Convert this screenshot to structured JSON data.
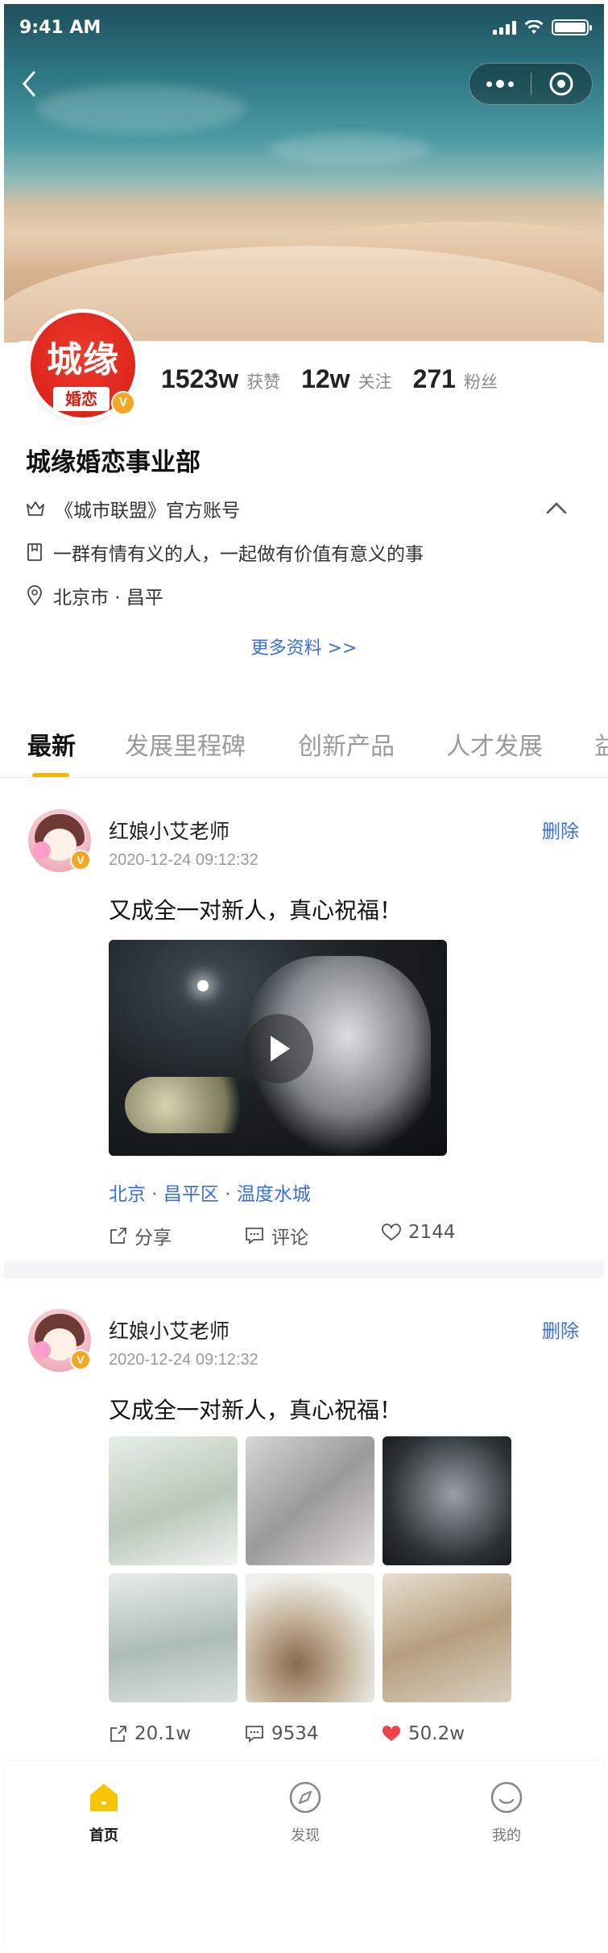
{
  "status_bar": {
    "time": "9:41 AM"
  },
  "profile": {
    "logo_text": "城缘",
    "logo_sub": "婚恋",
    "verified_mark": "V",
    "stats": [
      {
        "value": "1523w",
        "label": "获赞"
      },
      {
        "value": "12w",
        "label": "关注"
      },
      {
        "value": "271",
        "label": "粉丝"
      }
    ],
    "name": "城缘婚恋事业部",
    "official": "《城市联盟》官方账号",
    "motto": "一群有情有义的人，一起做有价值有意义的事",
    "location": "北京市 · 昌平",
    "more_link": "更多资料 >>"
  },
  "tabs": [
    "最新",
    "发展里程碑",
    "创新产品",
    "人才发展",
    "益"
  ],
  "posts": [
    {
      "author": "红娘小艾老师",
      "time": "2020-12-24  09:12:32",
      "delete_label": "删除",
      "text": "又成全一对新人，真心祝福！",
      "location": "北京 · 昌平区 · 温度水城",
      "share": "分享",
      "comment": "评论",
      "likes": "2144"
    },
    {
      "author": "红娘小艾老师",
      "time": "2020-12-24  09:12:32",
      "delete_label": "删除",
      "text": "又成全一对新人，真心祝福！",
      "share": "20.1w",
      "comment": "9534",
      "likes": "50.2w"
    }
  ],
  "bottom_nav": [
    {
      "label": "首页",
      "icon": "home-icon",
      "active": true
    },
    {
      "label": "发现",
      "icon": "compass-icon",
      "active": false
    },
    {
      "label": "我的",
      "icon": "smile-icon",
      "active": false
    }
  ],
  "colors": {
    "accent": "#f7b500",
    "link": "#3a6fd8",
    "brand_red": "#d41d15",
    "like_red": "#f0424c"
  }
}
